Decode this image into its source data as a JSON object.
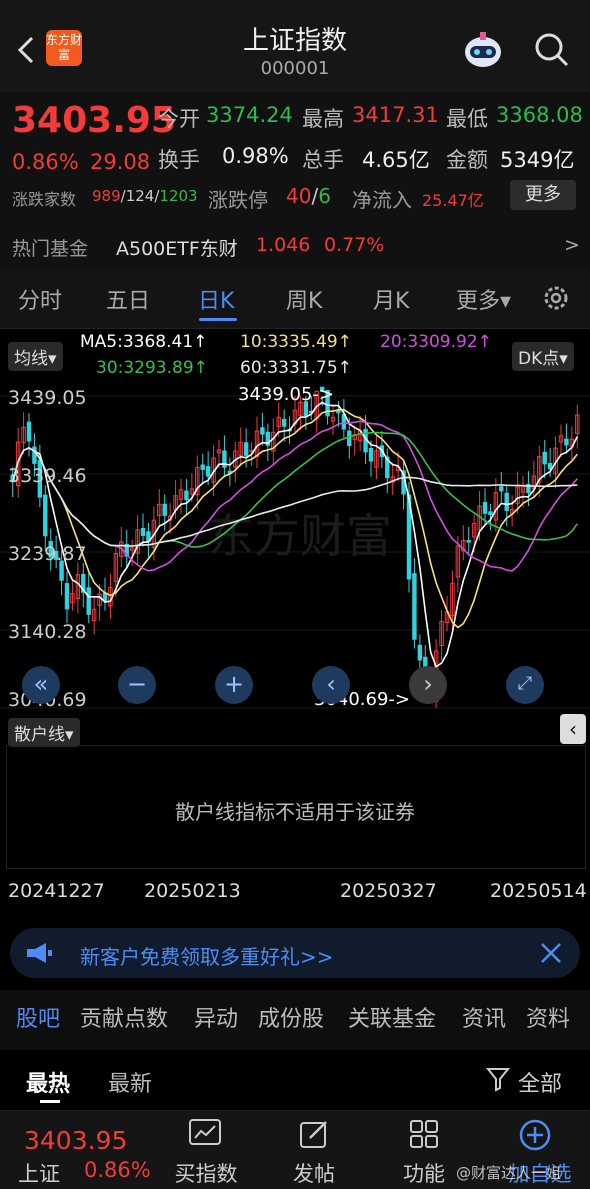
{
  "header": {
    "title": "上证指数",
    "code": "000001",
    "brand_logo_text": "东方财富"
  },
  "quote": {
    "price": "3403.95",
    "change_pct": "0.86%",
    "change": "29.08",
    "open_label": "今开",
    "open": "3374.24",
    "high_label": "最高",
    "high": "3417.31",
    "low_label": "最低",
    "low": "3368.08",
    "turnover_label": "换手",
    "turnover": "0.98%",
    "volume_label": "总手",
    "volume": "4.65亿",
    "amount_label": "金额",
    "amount": "5349亿",
    "breadth_label": "涨跌家数",
    "up_count": "989",
    "flat_count": "124",
    "down_count": "1203",
    "limit_label": "涨跌停",
    "limit_up": "40",
    "limit_down": "6",
    "inflow_label": "净流入",
    "inflow": "25.47亿",
    "more_button": "更多"
  },
  "hot_fund": {
    "label": "热门基金",
    "name": "A500ETF东财",
    "price": "1.046",
    "pct": "0.77%",
    "arrow": ">"
  },
  "tabs": [
    "分时",
    "五日",
    "日K",
    "周K",
    "月K",
    "更多▾"
  ],
  "active_tab": "日K",
  "chart_controls": {
    "ma_select": "均线▾",
    "dk_select": "DK点▾",
    "ma5": "MA5:3368.41↑",
    "ma10": "10:3335.49↑",
    "ma20": "20:3309.92↑",
    "ma30": "30:3293.89↑",
    "ma60": "60:3331.75↑",
    "high_marker": "3439.05->",
    "low_marker": "3040.69->",
    "watermark": "东方财富"
  },
  "chart_data": {
    "type": "candlestick",
    "y_ticks": [
      "3439.05",
      "3339.46",
      "3239.87",
      "3140.28",
      "3040.69"
    ],
    "x_ticks": [
      "20241227",
      "20250213",
      "20250327",
      "20250514"
    ],
    "ylim": [
      3040.69,
      3439.05
    ],
    "colors": {
      "up": "#f23b3b",
      "down": "#2fd3e0",
      "ma5": "#ffffff",
      "ma10": "#f5e27a",
      "ma20": "#d34ee0",
      "ma30": "#35c24a",
      "ma60": "#e8e8e8"
    }
  },
  "indicator": {
    "select": "散户线▾",
    "message": "散户线指标不适用于该证券"
  },
  "promo": {
    "text": "新客户免费领取多重好礼>>"
  },
  "section_tabs": [
    "股吧",
    "贡献点数",
    "异动",
    "成份股",
    "关联基金",
    "资讯",
    "资料"
  ],
  "subtabs": {
    "hot": "最热",
    "latest": "最新",
    "all": "全部"
  },
  "bottom_bar": {
    "price": "3403.95",
    "name": "上证",
    "pct": "0.86%",
    "buy_index": "买指数",
    "post": "发帖",
    "features": "功能",
    "add": "加自选",
    "watermark": "@财富达人一姐"
  }
}
